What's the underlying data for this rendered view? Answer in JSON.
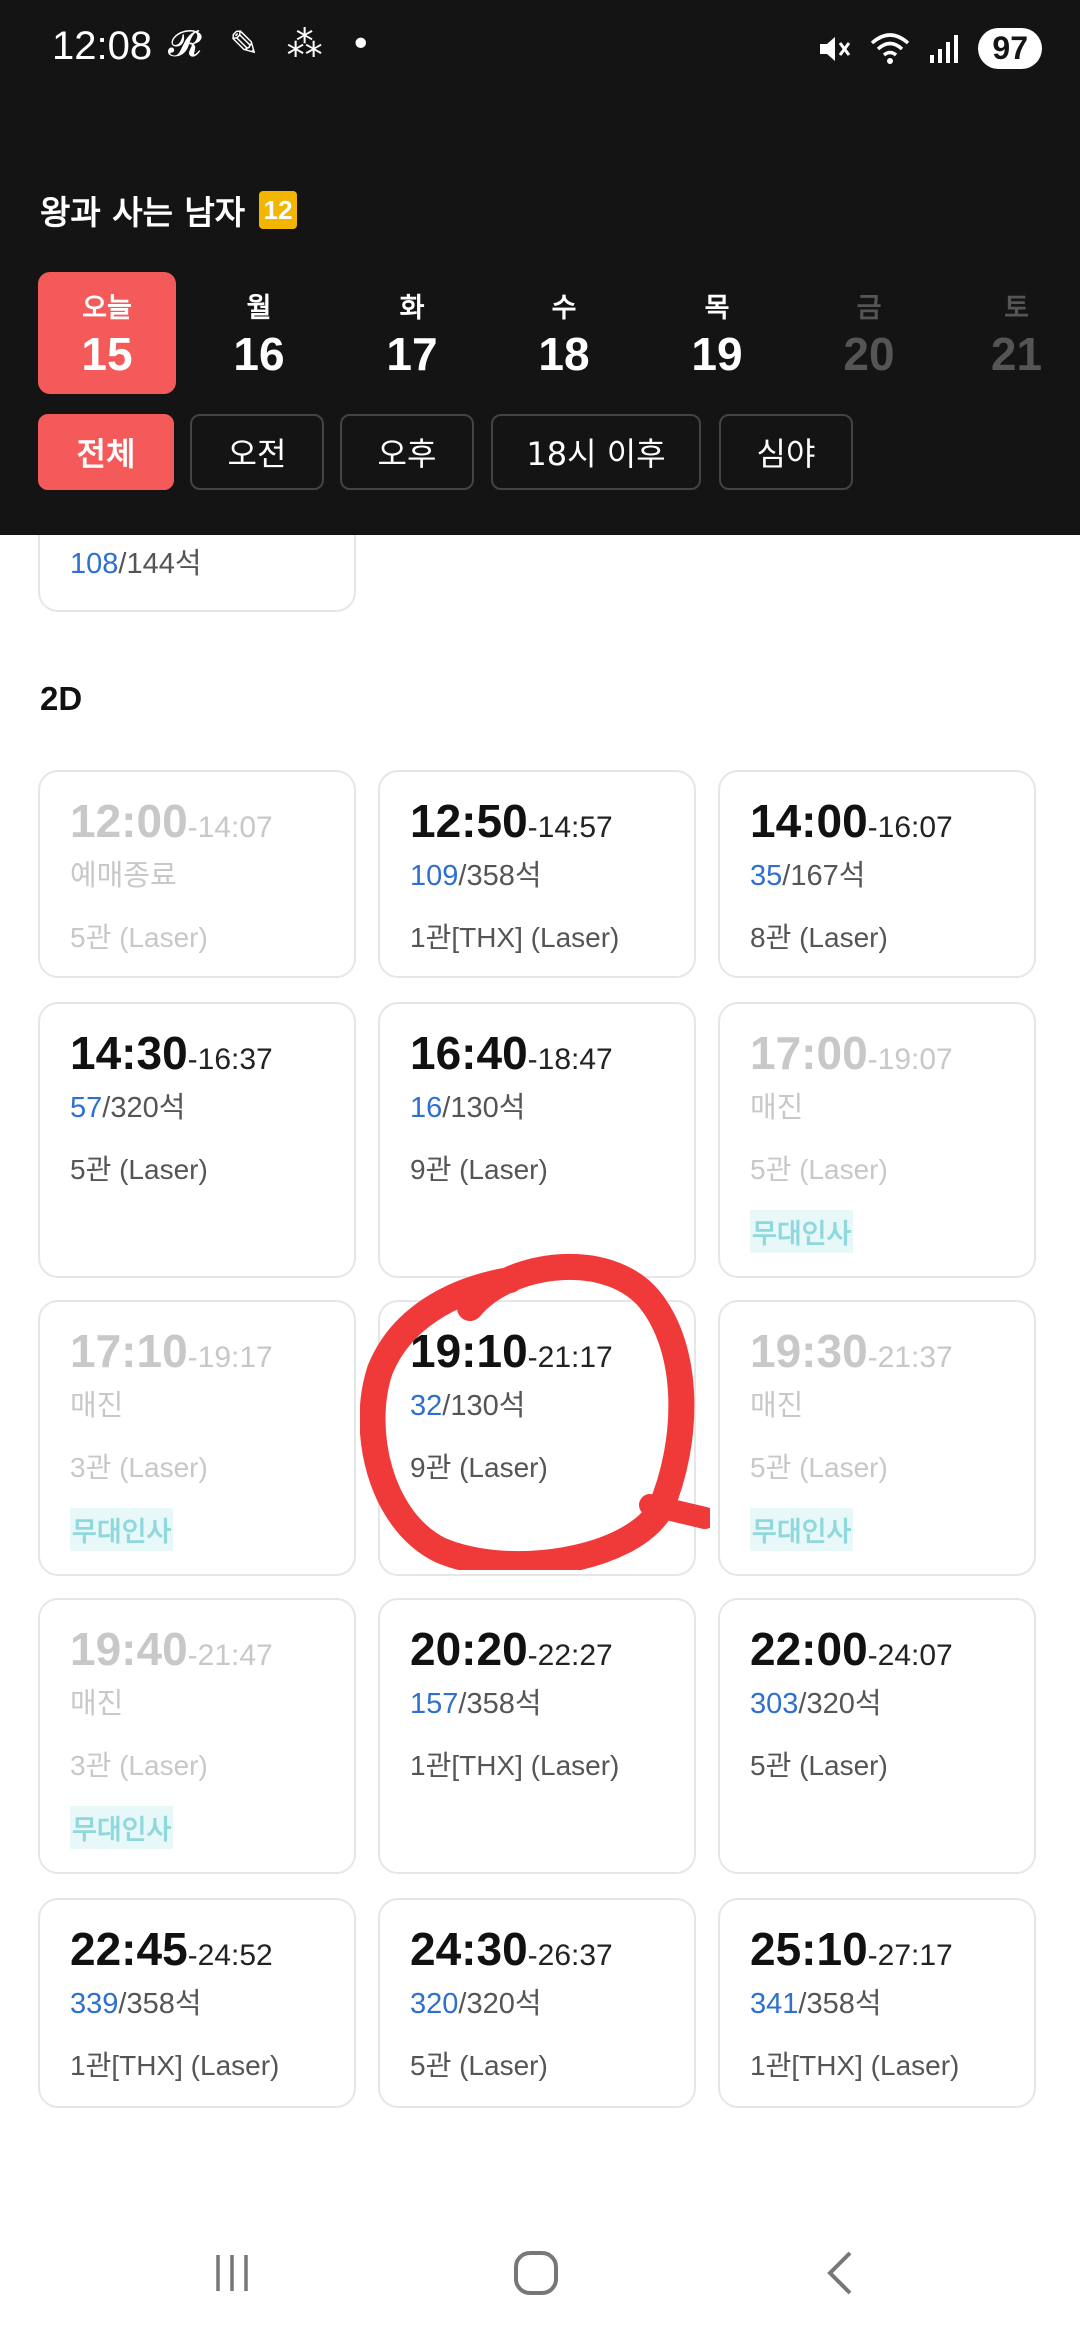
{
  "status_bar": {
    "time": "12:08",
    "notifications": "𝓡 ✎ ⁂ •",
    "battery": "97"
  },
  "movie": {
    "title": "왕과 사는 남자",
    "rating": "12"
  },
  "dates": [
    {
      "dow": "오늘",
      "num": "15",
      "active": true,
      "disabled": false
    },
    {
      "dow": "월",
      "num": "16",
      "active": false,
      "disabled": false
    },
    {
      "dow": "화",
      "num": "17",
      "active": false,
      "disabled": false
    },
    {
      "dow": "수",
      "num": "18",
      "active": false,
      "disabled": false
    },
    {
      "dow": "목",
      "num": "19",
      "active": false,
      "disabled": false
    },
    {
      "dow": "금",
      "num": "20",
      "active": false,
      "disabled": true
    },
    {
      "dow": "토",
      "num": "21",
      "active": false,
      "disabled": true
    }
  ],
  "filters": [
    "전체",
    "오전",
    "오후",
    "18시 이후",
    "심야"
  ],
  "partial_card": {
    "avail": "108",
    "total": "144석"
  },
  "section_title": "2D",
  "showtimes": [
    {
      "start": "12:00",
      "end": "-14:07",
      "status": "예매종료",
      "hall": "5관 (Laser)",
      "off": true
    },
    {
      "start": "12:50",
      "end": "-14:57",
      "avail": "109",
      "total": "358석",
      "hall": "1관[THX] (Laser)",
      "off": false
    },
    {
      "start": "14:00",
      "end": "-16:07",
      "avail": "35",
      "total": "167석",
      "hall": "8관 (Laser)",
      "off": false
    },
    {
      "start": "14:30",
      "end": "-16:37",
      "avail": "57",
      "total": "320석",
      "hall": "5관 (Laser)",
      "off": false
    },
    {
      "start": "16:40",
      "end": "-18:47",
      "avail": "16",
      "total": "130석",
      "hall": "9관 (Laser)",
      "off": false
    },
    {
      "start": "17:00",
      "end": "-19:07",
      "status": "매진",
      "hall": "5관 (Laser)",
      "tag": "무대인사",
      "off": true
    },
    {
      "start": "17:10",
      "end": "-19:17",
      "status": "매진",
      "hall": "3관 (Laser)",
      "tag": "무대인사",
      "off": true
    },
    {
      "start": "19:10",
      "end": "-21:17",
      "avail": "32",
      "total": "130석",
      "hall": "9관 (Laser)",
      "off": false
    },
    {
      "start": "19:30",
      "end": "-21:37",
      "status": "매진",
      "hall": "5관 (Laser)",
      "tag": "무대인사",
      "off": true
    },
    {
      "start": "19:40",
      "end": "-21:47",
      "status": "매진",
      "hall": "3관 (Laser)",
      "tag": "무대인사",
      "off": true
    },
    {
      "start": "20:20",
      "end": "-22:27",
      "avail": "157",
      "total": "358석",
      "hall": "1관[THX] (Laser)",
      "off": false
    },
    {
      "start": "22:00",
      "end": "-24:07",
      "avail": "303",
      "total": "320석",
      "hall": "5관 (Laser)",
      "off": false
    },
    {
      "start": "22:45",
      "end": "-24:52",
      "avail": "339",
      "total": "358석",
      "hall": "1관[THX] (Laser)",
      "off": false
    },
    {
      "start": "24:30",
      "end": "-26:37",
      "avail": "320",
      "total": "320석",
      "hall": "5관 (Laser)",
      "off": false
    },
    {
      "start": "25:10",
      "end": "-27:17",
      "avail": "341",
      "total": "358석",
      "hall": "1관[THX] (Laser)",
      "off": false
    }
  ],
  "colors": {
    "accent": "#f55a5a",
    "header_bg": "#141414",
    "seat_blue": "#2f6fd0",
    "tag_teal": "#2bb7c0",
    "annotation_red": "#f03a3a"
  },
  "icons": {
    "mute": "mute-icon",
    "wifi": "wifi-icon",
    "signal": "signal-icon",
    "nav_recent": "recent-apps-icon",
    "nav_home": "home-icon",
    "nav_back": "back-icon"
  }
}
